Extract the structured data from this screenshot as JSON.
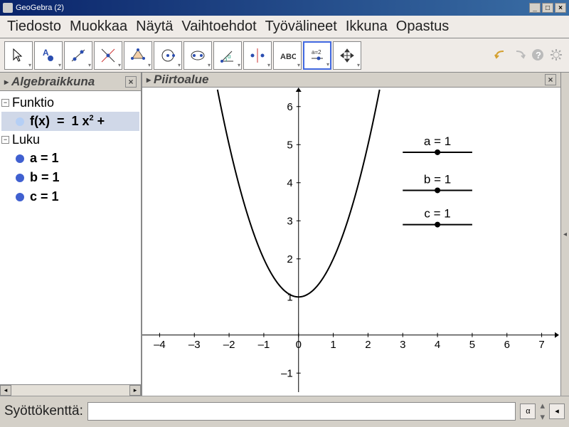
{
  "window": {
    "title": "GeoGebra (2)"
  },
  "menu": {
    "file": "Tiedosto",
    "edit": "Muokkaa",
    "view": "Näytä",
    "options": "Vaihtoehdot",
    "tools": "Työvälineet",
    "window": "Ikkuna",
    "help": "Opastus"
  },
  "panels": {
    "algebra": "Algebraikkuna",
    "drawing": "Piirtoalue"
  },
  "tree": {
    "func_cat": "Funktio",
    "func_item": "f(x) = 1 x² +",
    "num_cat": "Luku",
    "a": "a = 1",
    "b": "b = 1",
    "c": "c = 1"
  },
  "input": {
    "label": "Syöttökenttä:",
    "value": ""
  },
  "chart_data": {
    "type": "line",
    "title": "",
    "xlabel": "",
    "ylabel": "",
    "xlim": [
      -4.5,
      7.5
    ],
    "ylim": [
      -1.5,
      6.5
    ],
    "x_ticks": [
      -4,
      -3,
      -2,
      -1,
      0,
      1,
      2,
      3,
      4,
      5,
      6,
      7
    ],
    "y_ticks": [
      -1,
      0,
      1,
      2,
      3,
      4,
      5,
      6
    ],
    "series": [
      {
        "name": "f(x)=x²+1",
        "x": [
          -2.4,
          -2,
          -1.5,
          -1,
          -0.5,
          0,
          0.5,
          1,
          1.5,
          2,
          2.4
        ],
        "y": [
          6.76,
          5,
          3.25,
          2,
          1.25,
          1,
          1.25,
          2,
          3.25,
          5,
          6.76
        ]
      }
    ],
    "sliders": [
      {
        "label": "a = 1",
        "pos": 4,
        "y": 4.8,
        "min": 3,
        "max": 5
      },
      {
        "label": "b = 1",
        "pos": 4,
        "y": 3.8,
        "min": 3,
        "max": 5
      },
      {
        "label": "c = 1",
        "pos": 4,
        "y": 2.9,
        "min": 3,
        "max": 5
      }
    ]
  },
  "slider_labels": {
    "a": "a = 1",
    "b": "b = 1",
    "c": "c = 1"
  }
}
